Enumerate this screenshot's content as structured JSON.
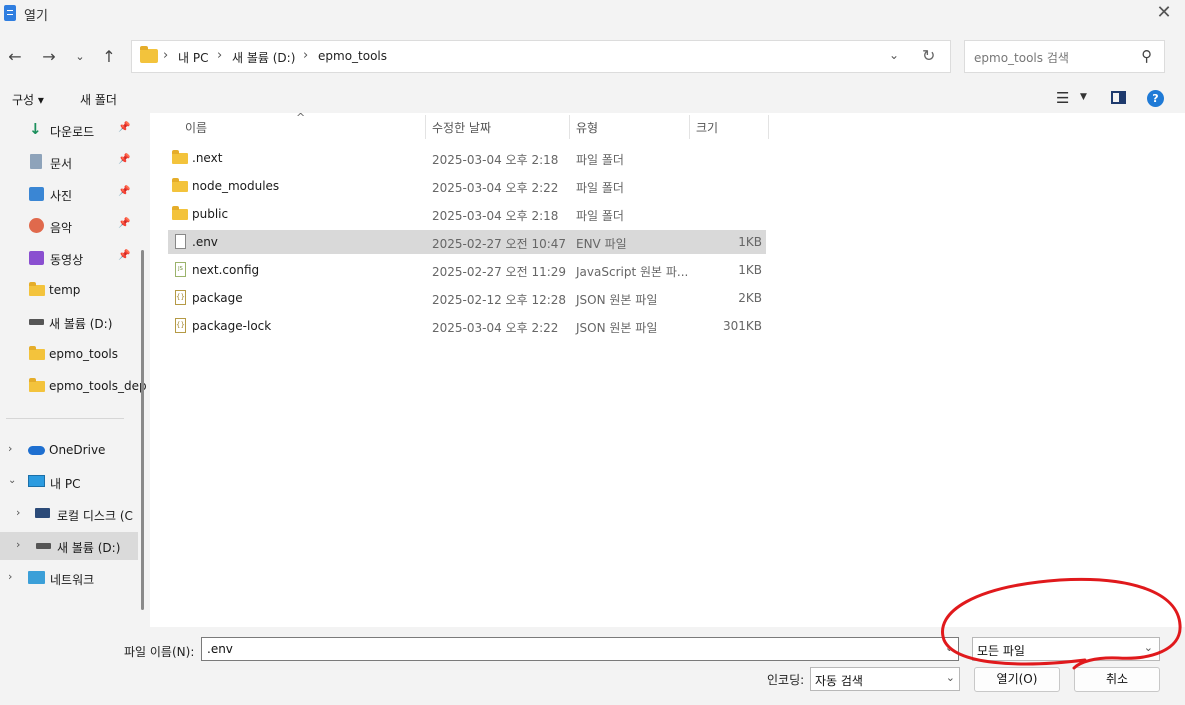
{
  "window": {
    "title": "열기"
  },
  "address": {
    "crumbs": [
      "내 PC",
      "새 볼륨 (D:)",
      "epmo_tools"
    ]
  },
  "search": {
    "placeholder": "epmo_tools 검색"
  },
  "toolbar": {
    "organize": "구성 ▾",
    "new_folder": "새 폴더"
  },
  "sidebar": {
    "quick": [
      {
        "label": "다운로드",
        "icon": "download-icon"
      },
      {
        "label": "문서",
        "icon": "document-icon"
      },
      {
        "label": "사진",
        "icon": "pictures-icon"
      },
      {
        "label": "음악",
        "icon": "music-icon"
      },
      {
        "label": "동영상",
        "icon": "video-icon"
      },
      {
        "label": "temp",
        "icon": "folder-icon"
      },
      {
        "label": "새 볼륨 (D:)",
        "icon": "drive-icon"
      },
      {
        "label": "epmo_tools",
        "icon": "folder-icon"
      },
      {
        "label": "epmo_tools_dep",
        "icon": "folder-icon"
      }
    ],
    "tree": [
      {
        "label": "OneDrive",
        "icon": "cloud-icon"
      },
      {
        "label": "내 PC",
        "icon": "computer-icon"
      },
      {
        "label": "로컬 디스크 (C",
        "icon": "local-disk-icon"
      },
      {
        "label": "새 볼륨 (D:)",
        "icon": "drive-icon"
      },
      {
        "label": "네트워크",
        "icon": "network-icon"
      }
    ]
  },
  "columns": {
    "name": "이름",
    "date": "수정한 날짜",
    "type": "유형",
    "size": "크기"
  },
  "files": [
    {
      "name": ".next",
      "date": "2025-03-04 오후 2:18",
      "type": "파일 폴더",
      "size": "",
      "icon": "folder-icon"
    },
    {
      "name": "node_modules",
      "date": "2025-03-04 오후 2:22",
      "type": "파일 폴더",
      "size": "",
      "icon": "folder-icon"
    },
    {
      "name": "public",
      "date": "2025-03-04 오후 2:18",
      "type": "파일 폴더",
      "size": "",
      "icon": "folder-icon"
    },
    {
      "name": ".env",
      "date": "2025-02-27 오전 10:47",
      "type": "ENV 파일",
      "size": "1KB",
      "icon": "file-icon"
    },
    {
      "name": "next.config",
      "date": "2025-02-27 오전 11:29",
      "type": "JavaScript 원본 파...",
      "size": "1KB",
      "icon": "js-file-icon"
    },
    {
      "name": "package",
      "date": "2025-02-12 오후 12:28",
      "type": "JSON 원본 파일",
      "size": "2KB",
      "icon": "json-file-icon"
    },
    {
      "name": "package-lock",
      "date": "2025-03-04 오후 2:22",
      "type": "JSON 원본 파일",
      "size": "301KB",
      "icon": "json-file-icon"
    }
  ],
  "footer": {
    "filename_label": "파일 이름(N):",
    "filename_value": ".env",
    "filetype_value": "모든 파일",
    "encoding_label": "인코딩:",
    "encoding_value": "자동 검색",
    "open_label": "열기(O)",
    "cancel_label": "취소"
  },
  "colors": {
    "annotation": "#e0191c",
    "accent": "#1f7ad6",
    "folder": "#f3c33c"
  }
}
